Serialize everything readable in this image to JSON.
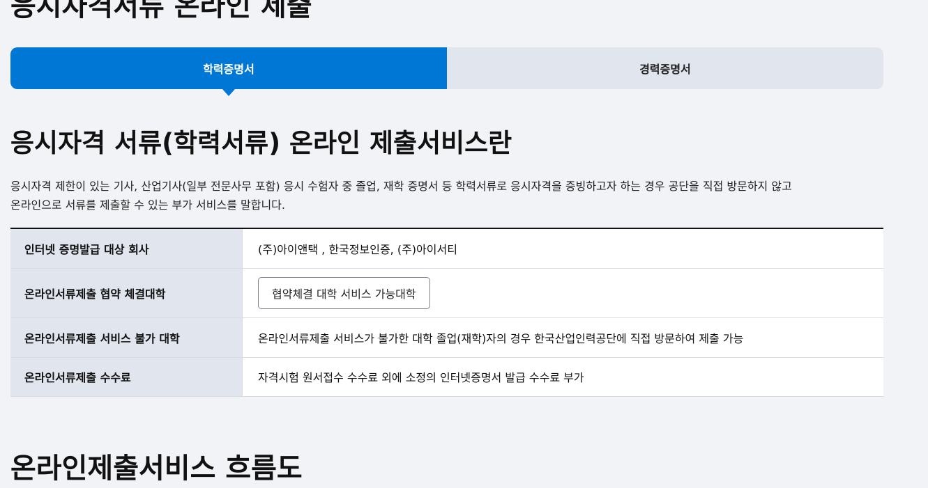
{
  "page": {
    "title": "응시자격서류 온라인 제출"
  },
  "tabs": [
    {
      "label": "학력증명서",
      "active": true
    },
    {
      "label": "경력증명서",
      "active": false
    }
  ],
  "section": {
    "title": "응시자격 서류(학력서류) 온라인 제출서비스란",
    "intro_line1": "응시자격 제한이 있는 기사, 산업기사(일부 전문사무 포함) 응시 수험자 중 졸업, 재학 증명서 등 학력서류로 응시자격을 증빙하고자 하는 경우 공단을 직접 방문하지 않고",
    "intro_line2": "온라인으로 서류를 제출할 수 있는 부가 서비스를 말합니다."
  },
  "info_table": {
    "rows": [
      {
        "header": "인터넷 증명발급 대상 회사",
        "value": "(주)아이앤택 , 한국정보인증, (주)아이서티"
      },
      {
        "header": "온라인서류제출 협약 체결대학",
        "button_label": "협약체결 대학 서비스 가능대학"
      },
      {
        "header": "온라인서류제출 서비스 불가 대학",
        "value": "온라인서류제출 서비스가 불가한 대학 졸업(재학)자의 경우 한국산업인력공단에 직접 방문하여 제출 가능"
      },
      {
        "header": "온라인서류제출 수수료",
        "value": "자격시험 원서접수 수수료 외에 소정의 인터넷증명서 발급 수수료 부가"
      }
    ]
  },
  "flow": {
    "title": "온라인제출서비스 흐름도"
  },
  "colors": {
    "accent": "#0077d4",
    "background": "#f2f3f7",
    "header_cell": "#e1e5ee"
  }
}
